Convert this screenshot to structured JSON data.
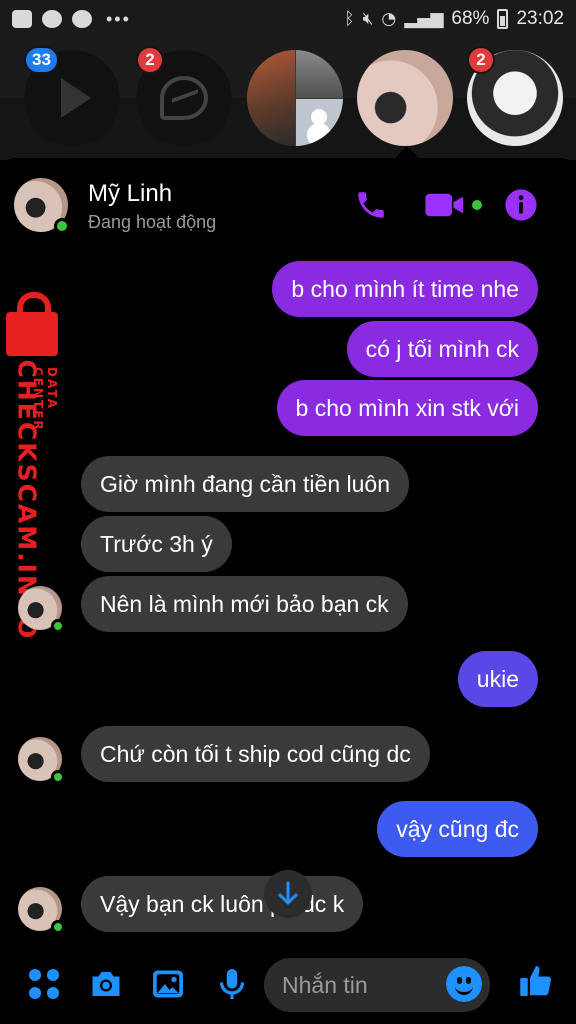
{
  "status_bar": {
    "battery_percent": "68%",
    "time": "23:02"
  },
  "chat_heads": [
    {
      "name": "video-app",
      "badge": "33"
    },
    {
      "name": "messenger-app",
      "badge": "2"
    },
    {
      "name": "group-chat",
      "badge": ""
    },
    {
      "name": "active-contact",
      "badge": ""
    },
    {
      "name": "contact-girl",
      "badge": "2"
    }
  ],
  "header": {
    "contact_name": "Mỹ Linh",
    "contact_status": "Đang hoạt động"
  },
  "watermark": {
    "brand": "CHECKSCAM.INFO",
    "sub": "DATA CENTER"
  },
  "messages": [
    {
      "dir": "out",
      "text": "b cho mình ít time nhe"
    },
    {
      "dir": "out",
      "text": "có j tối mình ck"
    },
    {
      "dir": "out",
      "text": "b cho mình xin stk với"
    },
    {
      "dir": "in",
      "text": "Giờ mình đang cần tiền luôn"
    },
    {
      "dir": "in",
      "text": "Trước 3h ý"
    },
    {
      "dir": "in",
      "text": "Nên là mình mới bảo bạn ck"
    },
    {
      "dir": "out",
      "text": "ukie"
    },
    {
      "dir": "in",
      "text": "Chứ còn tối t ship cod cũng dc"
    },
    {
      "dir": "out",
      "text": "vậy cũng đc"
    },
    {
      "dir": "in",
      "text": "Vậy bạn ck luôn       p t dc k"
    }
  ],
  "composer": {
    "placeholder": "Nhắn tin"
  },
  "colors": {
    "accent_purple": "#8a2be2",
    "accent_blue": "#3d5af1",
    "incoming_bubble": "#3a3a3c",
    "online_green": "#3cc53c"
  }
}
